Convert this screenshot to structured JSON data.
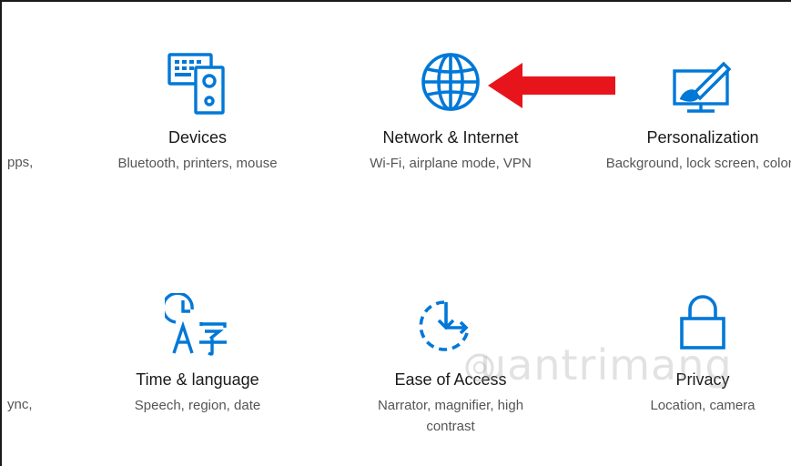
{
  "partial_left": {
    "row1": "pps,",
    "row2": "ync,"
  },
  "tiles": [
    {
      "title": "Devices",
      "desc": "Bluetooth, printers, mouse",
      "icon": "devices-icon"
    },
    {
      "title": "Network & Internet",
      "desc": "Wi-Fi, airplane mode, VPN",
      "icon": "globe-icon"
    },
    {
      "title": "Personalization",
      "desc": "Background, lock screen, colors",
      "icon": "personalization-icon"
    },
    {
      "title": "Time & language",
      "desc": "Speech, region, date",
      "icon": "time-language-icon"
    },
    {
      "title": "Ease of Access",
      "desc": "Narrator, magnifier, high contrast",
      "icon": "ease-of-access-icon"
    },
    {
      "title": "Privacy",
      "desc": "Location, camera",
      "icon": "lock-icon"
    }
  ],
  "annotation": {
    "arrow_color": "#e8141b",
    "arrow_icon": "red-arrow-icon"
  },
  "watermark": {
    "text": "uantrimang"
  },
  "colors": {
    "accent": "#0078d7",
    "title_text": "#1a1a1a",
    "desc_text": "#555555"
  }
}
